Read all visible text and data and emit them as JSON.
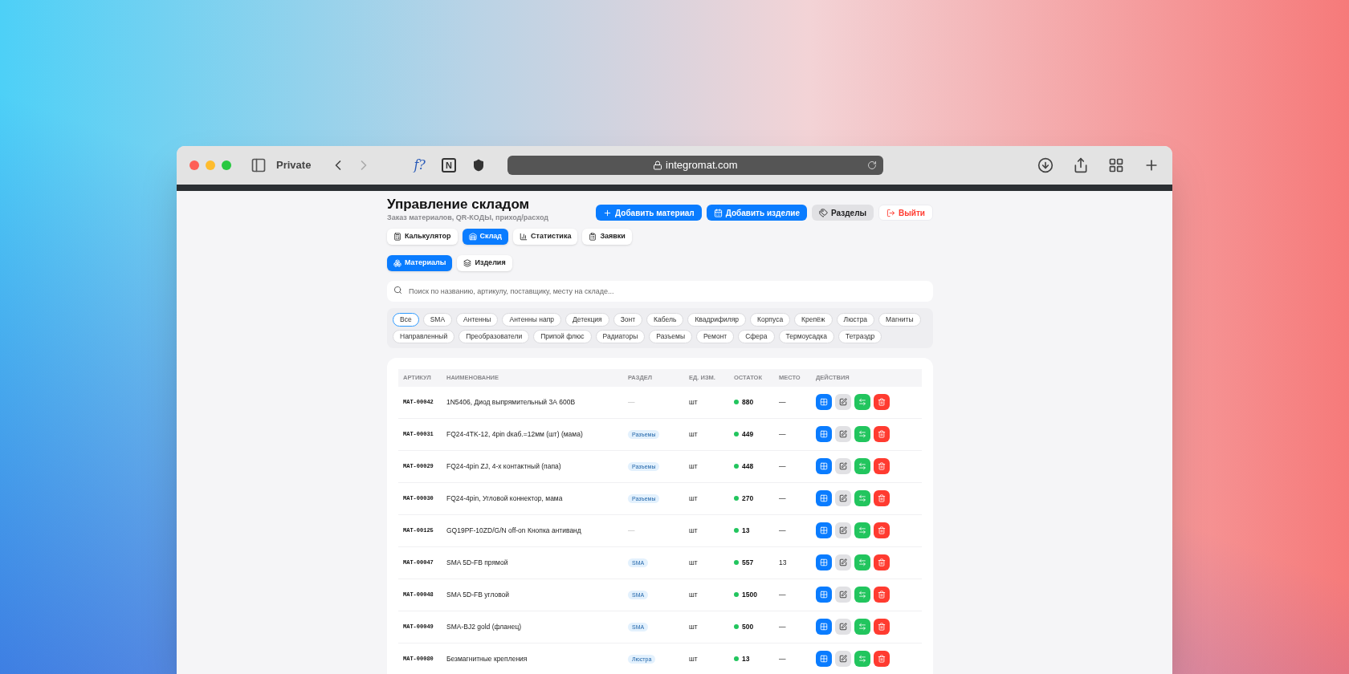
{
  "browser": {
    "mode_label": "Private",
    "extensions": [
      "f?",
      "N"
    ],
    "url": "integromat.com"
  },
  "header": {
    "title": "Управление складом",
    "subtitle": "Заказ материалов, QR-КОДЫ, приход/расход",
    "actions": [
      {
        "label": "Добавить материал",
        "kind": "primary"
      },
      {
        "label": "Добавить изделие",
        "kind": "primary"
      },
      {
        "label": "Разделы",
        "kind": "secondary"
      },
      {
        "label": "Выйти",
        "kind": "danger"
      }
    ]
  },
  "tabs": [
    {
      "label": "Калькулятор",
      "selected": false
    },
    {
      "label": "Склад",
      "selected": true
    },
    {
      "label": "Статистика",
      "selected": false
    },
    {
      "label": "Заявки",
      "selected": false
    }
  ],
  "subtabs": [
    {
      "label": "Материалы",
      "selected": true
    },
    {
      "label": "Изделия",
      "selected": false
    }
  ],
  "search": {
    "placeholder": "Поиск по названию, артикулу, поставщику, месту на складе..."
  },
  "categories": [
    {
      "label": "Все",
      "selected": true
    },
    {
      "label": "SMA",
      "selected": false
    },
    {
      "label": "Антенны",
      "selected": false
    },
    {
      "label": "Антенны напр",
      "selected": false
    },
    {
      "label": "Детекция",
      "selected": false
    },
    {
      "label": "Зонт",
      "selected": false
    },
    {
      "label": "Кабель",
      "selected": false
    },
    {
      "label": "Квадрифиляр",
      "selected": false
    },
    {
      "label": "Корпуса",
      "selected": false
    },
    {
      "label": "Крепёж",
      "selected": false
    },
    {
      "label": "Люстра",
      "selected": false
    },
    {
      "label": "Магниты",
      "selected": false
    },
    {
      "label": "Направленный",
      "selected": false
    },
    {
      "label": "Преобразователи",
      "selected": false
    },
    {
      "label": "Припой флюс",
      "selected": false
    },
    {
      "label": "Радиаторы",
      "selected": false
    },
    {
      "label": "Разъемы",
      "selected": false
    },
    {
      "label": "Ремонт",
      "selected": false
    },
    {
      "label": "Сфера",
      "selected": false
    },
    {
      "label": "Термоусадка",
      "selected": false
    },
    {
      "label": "Тетраэдр",
      "selected": false
    }
  ],
  "table": {
    "columns": [
      "АРТИКУЛ",
      "НАИМЕНОВАНИЕ",
      "РАЗДЕЛ",
      "ЕД. ИЗМ.",
      "ОСТАТОК",
      "МЕСТО",
      "ДЕЙСТВИЯ"
    ],
    "rows": [
      {
        "sku": "MAT-00042",
        "name": "1N5406, Диод выпрямительный 3А 600В",
        "section": {
          "kind": "empty",
          "label": "—"
        },
        "unit": "шт",
        "stock": "880",
        "place": "—"
      },
      {
        "sku": "MAT-00031",
        "name": "FQ24-4TK-12, 4pin dкаб.=12мм (шт) (мама)",
        "section": {
          "kind": "tag",
          "label": "Разъемы"
        },
        "unit": "шт",
        "stock": "449",
        "place": "—"
      },
      {
        "sku": "MAT-00029",
        "name": "FQ24-4pin ZJ, 4-х контактный (папа)",
        "section": {
          "kind": "tag",
          "label": "Разъемы"
        },
        "unit": "шт",
        "stock": "448",
        "place": "—"
      },
      {
        "sku": "MAT-00030",
        "name": "FQ24-4pin, Угловой коннектор, мама",
        "section": {
          "kind": "tag",
          "label": "Разъемы"
        },
        "unit": "шт",
        "stock": "270",
        "place": "—"
      },
      {
        "sku": "MAT-00125",
        "name": "GQ19PF-10ZD/G/N off-on Кнопка антиванд",
        "section": {
          "kind": "empty",
          "label": "—"
        },
        "unit": "шт",
        "stock": "13",
        "place": "—"
      },
      {
        "sku": "MAT-00047",
        "name": "SMA 5D-FB прямой",
        "section": {
          "kind": "tag",
          "label": "SMA"
        },
        "unit": "шт",
        "stock": "557",
        "place": "13"
      },
      {
        "sku": "MAT-00048",
        "name": "SMA 5D-FB угловой",
        "section": {
          "kind": "tag",
          "label": "SMA"
        },
        "unit": "шт",
        "stock": "1500",
        "place": "—"
      },
      {
        "sku": "MAT-00049",
        "name": "SMA-BJ2 gold (фланец)",
        "section": {
          "kind": "tag",
          "label": "SMA"
        },
        "unit": "шт",
        "stock": "500",
        "place": "—"
      },
      {
        "sku": "MAT-00080",
        "name": "Безмагнитные крепления",
        "section": {
          "kind": "tag",
          "label": "Люстра"
        },
        "unit": "шт",
        "stock": "13",
        "place": "—"
      }
    ]
  }
}
